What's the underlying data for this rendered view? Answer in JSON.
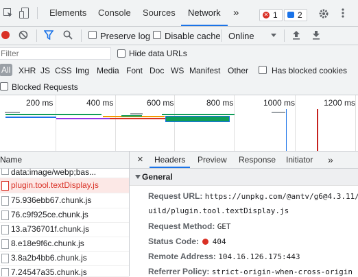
{
  "tabs": {
    "elements": "Elements",
    "console": "Console",
    "sources": "Sources",
    "network": "Network",
    "more": "»",
    "errors_count": "1",
    "messages_count": "2"
  },
  "toolbar": {
    "preserve_log": "Preserve log",
    "disable_cache": "Disable cache",
    "throttle": "Online"
  },
  "filter": {
    "placeholder": "Filter",
    "hide_data_urls": "Hide data URLs"
  },
  "types": [
    "All",
    "XHR",
    "JS",
    "CSS",
    "Img",
    "Media",
    "Font",
    "Doc",
    "WS",
    "Manifest",
    "Other"
  ],
  "has_blocked_cookies": "Has blocked cookies",
  "blocked_requests": "Blocked Requests",
  "overview_ticks": [
    "200 ms",
    "400 ms",
    "600 ms",
    "800 ms",
    "1000 ms",
    "1200 ms"
  ],
  "list": {
    "header": "Name",
    "items": [
      {
        "name": "data:image/webp;bas...",
        "error": false
      },
      {
        "name": "plugin.tool.textDisplay.js",
        "error": true
      },
      {
        "name": "75.936ebb67.chunk.js",
        "error": false
      },
      {
        "name": "76.c9f925ce.chunk.js",
        "error": false
      },
      {
        "name": "13.a736701f.chunk.js",
        "error": false
      },
      {
        "name": "8.e18e9f6c.chunk.js",
        "error": false
      },
      {
        "name": "3.8a2b4bb6.chunk.js",
        "error": false
      },
      {
        "name": "7.24547a35.chunk.js",
        "error": false
      }
    ]
  },
  "details": {
    "close": "×",
    "tabs": [
      "Headers",
      "Preview",
      "Response",
      "Initiator"
    ],
    "more": "»",
    "section": "General",
    "request_url_label": "Request URL:",
    "request_url_line1": "https://unpkg.com/@antv/g6@4.3.11/",
    "request_url_line2": "uild/plugin.tool.textDisplay.js",
    "method_label": "Request Method:",
    "method": "GET",
    "status_label": "Status Code:",
    "status": "404",
    "remote_label": "Remote Address:",
    "remote": "104.16.126.175:443",
    "referrer_label": "Referrer Policy:",
    "referrer": "strict-origin-when-cross-origin"
  },
  "colors": {
    "accent": "#1a73e8",
    "record": "#d93025",
    "error": "#d93025"
  }
}
